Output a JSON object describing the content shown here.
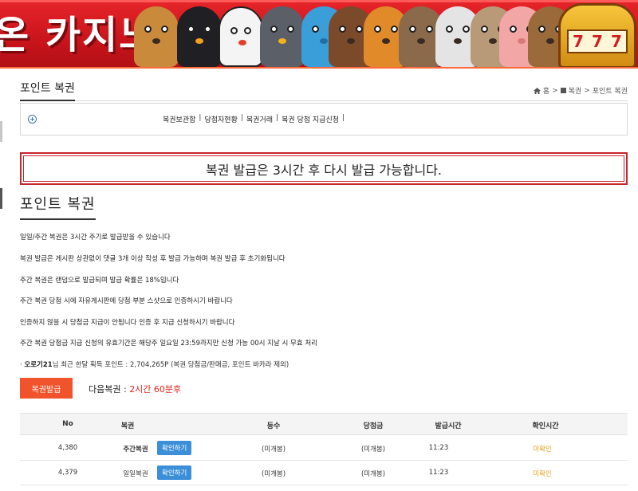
{
  "banner": {
    "title": "온 카지노",
    "slot_symbols": [
      "7",
      "7",
      "7"
    ]
  },
  "page": {
    "title": "포인트 복권",
    "breadcrumb": [
      "홈",
      ">",
      "복권",
      ">",
      "포인트 복권"
    ]
  },
  "submenu": {
    "links": [
      "복권보관함",
      "당첨자현황",
      "복권거래",
      "복권 당첨 지급신청"
    ]
  },
  "notice": {
    "text": "복권 발급은 3시간 후 다시 발급 가능합니다."
  },
  "section": {
    "heading": "포인트 복권"
  },
  "rules": [
    "일일/주간 복권은 3시간 주기로 발급받을 수 있습니다",
    "복권 발급은 게시판 상관없이 댓글 3개 이상 작성 후 발급 가능하며 복권 발급 후 초기화됩니다",
    "주간 복권은 랜덤으로 발급되며 발급 확률은 18%입니다",
    "주간 복권 당첨 시에 자유게시판에 당첨 부분 스샷으로 인증하시기 바랍니다",
    "인증하지 않을 시 당첨금 지급이 안됩니다 인증 후 지급 신청하시기 바랍니다",
    "주간 복권 당첨금 지급 신청의 유효기간은 해당주 일요일 23:59까지만 신청 가능 00시 지날 시 무효 처리"
  ],
  "points": {
    "prefix": "·",
    "nickname": "오로기21",
    "text": "님 최근 한달 획득 포인트 : 2,704,265P (복권 당첨금/판매금, 포인트 바카라 제외)"
  },
  "issue": {
    "button_label": "복권발급",
    "next_label": "다음복권 :",
    "next_timer": "2시간 60분후"
  },
  "table": {
    "headers": [
      "No",
      "복권",
      "등수",
      "당첨금",
      "발급시간",
      "확인시간"
    ],
    "rows": [
      {
        "no": "4,380",
        "type": "주간복권",
        "type_bold": true,
        "action": "확인하기",
        "rank": "(미개봉)",
        "prize": "(미개봉)",
        "issued": "11:23",
        "confirmed": "미확인"
      },
      {
        "no": "4,379",
        "type": "일일복권",
        "type_bold": false,
        "action": "확인하기",
        "rank": "(미개봉)",
        "prize": "(미개봉)",
        "issued": "11:23",
        "confirmed": "미확인"
      }
    ]
  },
  "colors": {
    "banner_red": "#d11f1f",
    "notice_border": "#c9252c",
    "issue_button": "#f1542c",
    "confirm_button": "#3a8fd8",
    "status_unconfirmed": "#e5a21b",
    "timer": "#e0251f"
  },
  "icons": {
    "home": "home-icon",
    "board": "board-icon",
    "expand": "plus-circle-icon"
  }
}
